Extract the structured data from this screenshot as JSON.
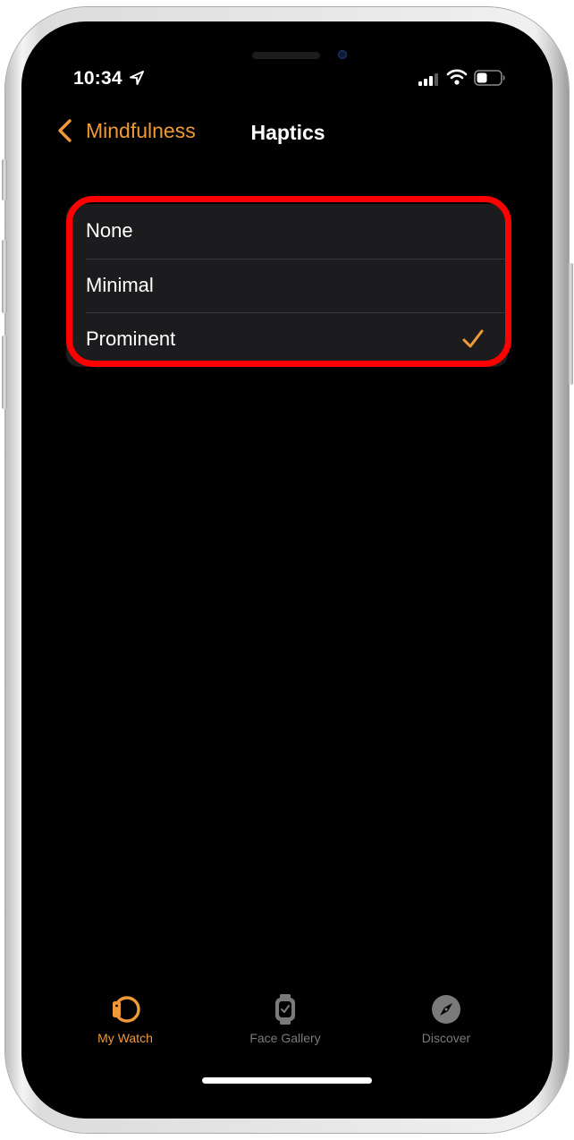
{
  "status_bar": {
    "time": "10:34",
    "location_icon": "location-arrow-icon",
    "signal_icon": "cellular-signal-icon",
    "wifi_icon": "wifi-icon",
    "battery_icon": "battery-icon"
  },
  "nav": {
    "back_label": "Mindfulness",
    "back_icon": "chevron-left-icon",
    "title": "Haptics"
  },
  "haptics_options": [
    {
      "label": "None",
      "selected": false
    },
    {
      "label": "Minimal",
      "selected": false
    },
    {
      "label": "Prominent",
      "selected": true
    }
  ],
  "tab_bar": {
    "tabs": [
      {
        "label": "My Watch",
        "icon": "my-watch-icon",
        "active": true
      },
      {
        "label": "Face Gallery",
        "icon": "face-gallery-icon",
        "active": false
      },
      {
        "label": "Discover",
        "icon": "discover-compass-icon",
        "active": false
      }
    ]
  },
  "colors": {
    "accent": "#f09a37",
    "highlight_annotation": "#ff0000",
    "inactive_tab": "#7a7a7a",
    "cell_background": "#1c1c1e"
  }
}
